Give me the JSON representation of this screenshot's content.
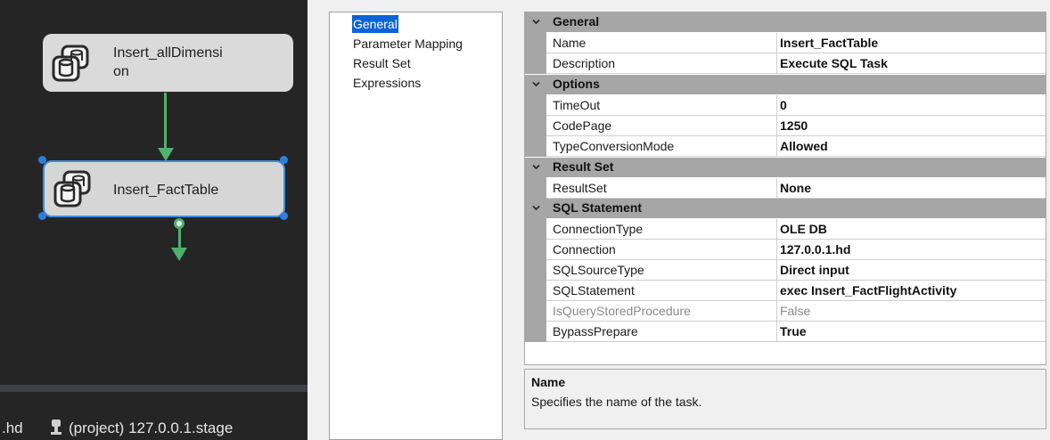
{
  "designer": {
    "tasks": [
      {
        "label": "Insert_allDimensi\non"
      },
      {
        "label": "Insert_FactTable"
      }
    ],
    "status": {
      "left_text": ".hd",
      "right_text": "(project) 127.0.0.1.stage"
    }
  },
  "nav": {
    "items": [
      "General",
      "Parameter Mapping",
      "Result Set",
      "Expressions"
    ],
    "selected": "General"
  },
  "properties": {
    "general": {
      "title": "General",
      "rows": [
        {
          "name": "Name",
          "value": "Insert_FactTable"
        },
        {
          "name": "Description",
          "value": "Execute SQL Task"
        }
      ]
    },
    "options": {
      "title": "Options",
      "rows": [
        {
          "name": "TimeOut",
          "value": "0"
        },
        {
          "name": "CodePage",
          "value": "1250"
        },
        {
          "name": "TypeConversionMode",
          "value": "Allowed"
        }
      ]
    },
    "result_set": {
      "title": "Result Set",
      "rows": [
        {
          "name": "ResultSet",
          "value": "None"
        }
      ]
    },
    "sql_statement": {
      "title": "SQL Statement",
      "rows": [
        {
          "name": "ConnectionType",
          "value": "OLE DB"
        },
        {
          "name": "Connection",
          "value": "127.0.0.1.hd"
        },
        {
          "name": "SQLSourceType",
          "value": "Direct input"
        },
        {
          "name": "SQLStatement",
          "value": "exec Insert_FactFlightActivity"
        },
        {
          "name": "IsQueryStoredProcedure",
          "value": "False",
          "disabled": true
        },
        {
          "name": "BypassPrepare",
          "value": "True"
        }
      ]
    }
  },
  "description": {
    "title": "Name",
    "text": "Specifies the name of the task."
  },
  "colors": {
    "designer_bg": "#252526",
    "selection_blue": "#0a64d6",
    "connector_green": "#4fb06f",
    "category_gray": "#a6a6a6"
  }
}
